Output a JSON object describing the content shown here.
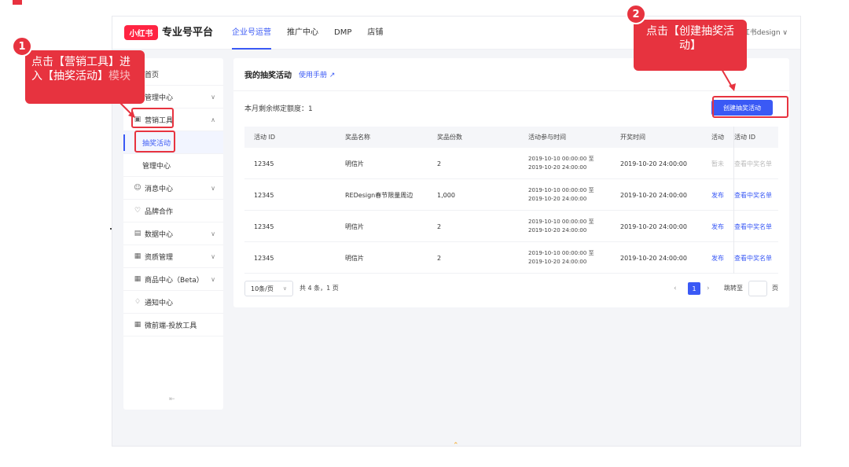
{
  "app": {
    "logo_badge": "小红书",
    "logo_text": "专业号平台",
    "user_name": "小红书design ∨"
  },
  "top_nav": [
    {
      "label": "企业号运营",
      "active": true
    },
    {
      "label": "推广中心",
      "active": false
    },
    {
      "label": "DMP",
      "active": false
    },
    {
      "label": "店铺",
      "active": false
    }
  ],
  "sidebar": {
    "items": [
      {
        "label": "首页",
        "icon": "home-icon"
      },
      {
        "label": "管理中心",
        "icon": "none"
      },
      {
        "label": "营销工具",
        "icon": "tool-icon"
      },
      {
        "label": "抽奖活动",
        "icon": "none"
      },
      {
        "label": "管理中心",
        "icon": "none"
      },
      {
        "label": "消息中心",
        "icon": "message-icon"
      },
      {
        "label": "品牌合作",
        "icon": "heart-icon"
      },
      {
        "label": "数据中心",
        "icon": "chart-icon"
      },
      {
        "label": "资质管理",
        "icon": "document-icon"
      },
      {
        "label": "商品中心（Beta）",
        "icon": "grid-icon"
      },
      {
        "label": "通知中心",
        "icon": "bell-icon"
      },
      {
        "label": "微前端-投放工具",
        "icon": "grid-icon"
      }
    ],
    "collapse_glyph": "⇤"
  },
  "panel": {
    "title": "我的抽奖活动",
    "manual_link": "使用手册 ↗",
    "quota_text": "本月剩余绑定额度：1",
    "create_button": "创建抽奖活动"
  },
  "table": {
    "headers": [
      "活动 ID",
      "奖品名称",
      "奖品份数",
      "活动参与时间",
      "开奖时间",
      "活动",
      "活动 ID"
    ],
    "rows": [
      {
        "id": "12345",
        "prize": "明信片",
        "count": "2",
        "time_start": "2019-10-10 00:00:00 至",
        "time_end": "2019-10-20 24:00:00",
        "draw_time": "2019-10-20 24:00:00",
        "action": "暂未",
        "winners": "查看中奖名单"
      },
      {
        "id": "12345",
        "prize": "REDesign春节限量周边",
        "count": "1,000",
        "time_start": "2019-10-10 00:00:00 至",
        "time_end": "2019-10-20 24:00:00",
        "draw_time": "2019-10-20 24:00:00",
        "action": "发布",
        "winners": "查看中奖名单"
      },
      {
        "id": "12345",
        "prize": "明信片",
        "count": "2",
        "time_start": "2019-10-10 00:00:00 至",
        "time_end": "2019-10-20 24:00:00",
        "draw_time": "2019-10-20 24:00:00",
        "action": "发布",
        "winners": "查看中奖名单"
      },
      {
        "id": "12345",
        "prize": "明信片",
        "count": "2",
        "time_start": "2019-10-10 00:00:00 至",
        "time_end": "2019-10-20 24:00:00",
        "draw_time": "2019-10-20 24:00:00",
        "action": "发布",
        "winners": "查看中奖名单"
      }
    ]
  },
  "pagination": {
    "page_size": "10条/页",
    "total": "共 4 条，1 页",
    "current_page": "1",
    "jump_label": "跳转至",
    "page_unit": "页"
  },
  "annotations": {
    "step1_number": "1",
    "step1_text": "点击【营销工具】进入【抽奖活动】",
    "step1_tail": "模块",
    "step2_number": "2",
    "step2_text": "点击【创建抽奖活动】"
  },
  "colors": {
    "primary": "#3a59f5",
    "annotation_red": "#e7333f",
    "brand_red": "#ff2442"
  }
}
